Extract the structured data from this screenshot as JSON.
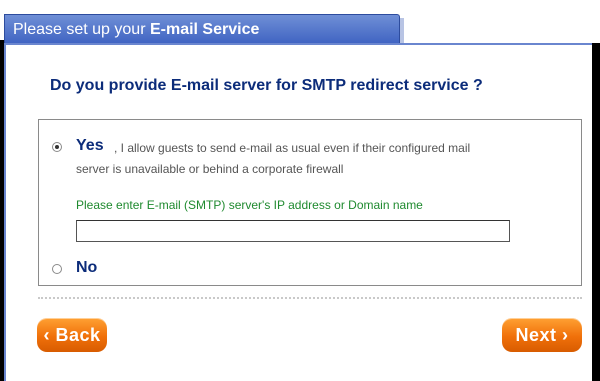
{
  "tab": {
    "prefix": "Please set up your ",
    "bold": "E-mail Service"
  },
  "question": "Do you provide E-mail server for SMTP redirect service ?",
  "options": {
    "yes": {
      "label": "Yes",
      "desc_line1": ", I allow guests to send e-mail as usual even if their configured mail",
      "desc_line2": "server is unavailable or behind a corporate firewall",
      "checked": true
    },
    "no": {
      "label": "No",
      "checked": false
    }
  },
  "smtp": {
    "prompt": "Please enter E-mail (SMTP) server's IP address or Domain name",
    "value": ""
  },
  "buttons": {
    "back_label": "Back",
    "next_label": "Next",
    "back_arrow": "‹",
    "next_arrow": "›"
  },
  "colors": {
    "accent": "#0c2c7a",
    "prompt_green": "#1f8a2f",
    "button_orange": "#f0700a",
    "tab_blue": "#3f63c2"
  }
}
